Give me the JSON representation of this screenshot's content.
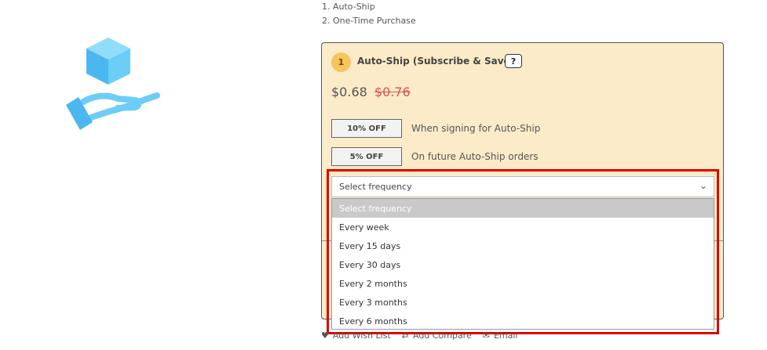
{
  "options": [
    "1. Auto-Ship",
    "2. One-Time Purchase"
  ],
  "card": {
    "step": "1",
    "title": "Auto-Ship (Subscribe & Save)",
    "help": "?",
    "price_current": "$0.68",
    "price_old": "$0.76",
    "discounts": [
      {
        "badge": "10% OFF",
        "text": "When signing for Auto-Ship"
      },
      {
        "badge": "5% OFF",
        "text": "On future Auto-Ship orders"
      }
    ],
    "select": {
      "value": "Select frequency"
    }
  },
  "dropdown": {
    "items": [
      "Select frequency",
      "Every week",
      "Every 15 days",
      "Every 30 days",
      "Every 2 months",
      "Every 3 months",
      "Every 6 months"
    ],
    "selected_index": 0
  },
  "footer": {
    "wish_list": "Add Wish List",
    "compare": "Add Compare",
    "email": "Email"
  },
  "colors": {
    "card_bg": "#fcebc8",
    "highlight": "#e00000",
    "old_price": "#d9534f",
    "icon_blue": "#5ec8f5"
  }
}
